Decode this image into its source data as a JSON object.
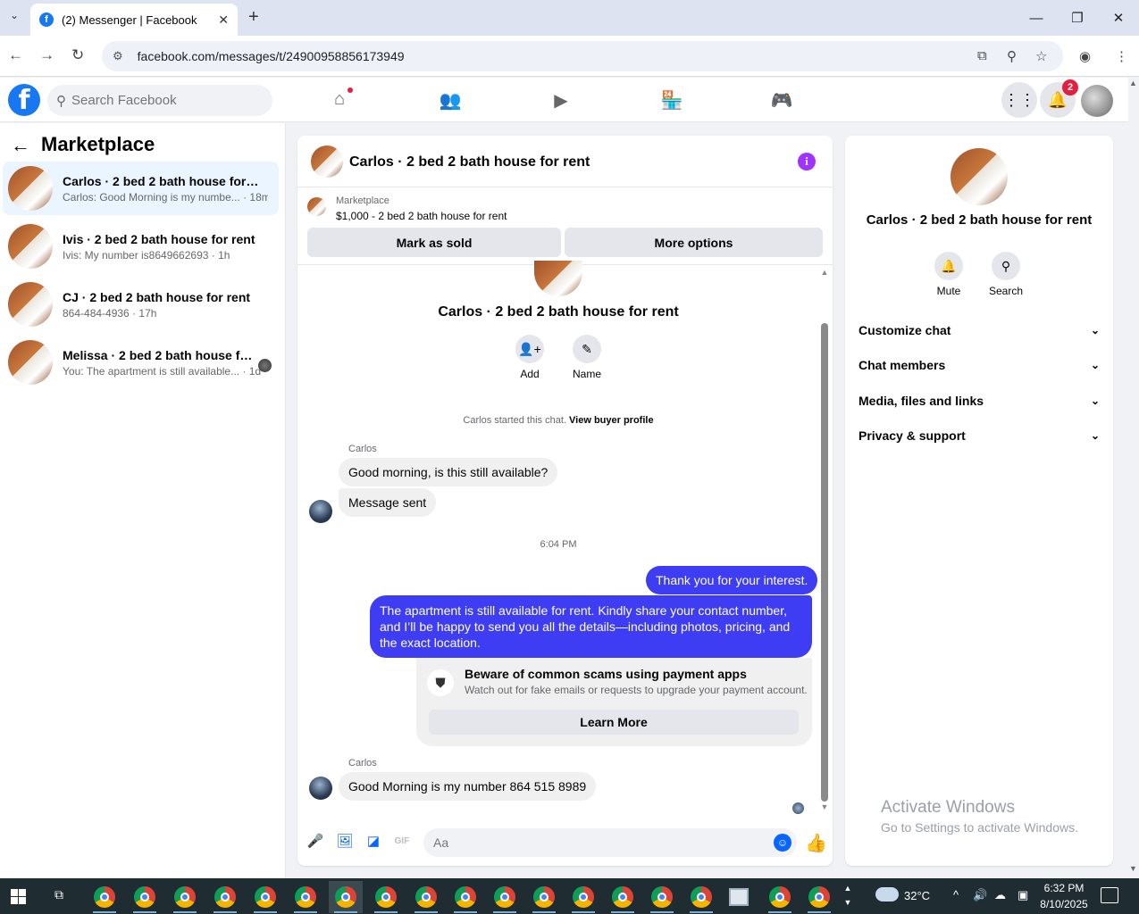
{
  "browser": {
    "tab_title": "(2) Messenger | Facebook",
    "tab_close": "✕",
    "new_tab": "+",
    "url": "facebook.com/messages/t/24900958856173949",
    "win_minimize": "—",
    "win_restore": "❐",
    "win_close": "✕"
  },
  "facebook": {
    "search_placeholder": "Search Facebook",
    "notification_count": "2"
  },
  "sidebar": {
    "title": "Marketplace",
    "conversations": [
      {
        "name": "Carlos · 2 bed 2 bath house for rent",
        "preview": "Carlos: Good Morning is my numbe... · 18m",
        "active": true
      },
      {
        "name": "Ivis · 2 bed 2 bath house for rent",
        "preview": "Ivis: My number is8649662693 · 1h",
        "active": false
      },
      {
        "name": "CJ · 2 bed 2 bath house for rent",
        "preview": "864-484-4936 · 17h",
        "active": false
      },
      {
        "name": "Melissa · 2 bed 2 bath house for...",
        "preview": "You: The apartment is still available... · 1d",
        "active": false
      }
    ]
  },
  "chat": {
    "title": "Carlos · 2 bed 2 bath house for rent",
    "marketplace_label": "Marketplace",
    "listing": "$1,000 - 2 bed 2 bath house for rent",
    "mark_sold": "Mark as sold",
    "more_options": "More options",
    "center_name": "Carlos · 2 bed 2 bath house for rent",
    "add_label": "Add",
    "name_label": "Name",
    "started_text": "Carlos started this chat.",
    "view_profile": "View buyer profile",
    "sender_1": "Carlos",
    "msg_1": "Good morning, is this still available?",
    "msg_2": "Message sent",
    "time_sep": "6:04 PM",
    "out_1": "Thank you for your interest.",
    "out_2": "The apartment is still available for rent. Kindly share your contact number, and I’ll be happy to send you all the details—including photos, pricing, and the exact location.",
    "scam_title": "Beware of common scams using payment apps",
    "scam_sub": "Watch out for fake emails or requests to upgrade your payment account.",
    "learn_more": "Learn More",
    "sender_2": "Carlos",
    "msg_3": "Good Morning is my number 864 515 8989",
    "input_placeholder": "Aa",
    "gif_label": "GIF"
  },
  "details": {
    "name": "Carlos · 2 bed 2 bath house for rent",
    "mute": "Mute",
    "search": "Search",
    "sections": [
      "Customize chat",
      "Chat members",
      "Media, files and links",
      "Privacy & support"
    ]
  },
  "watermark": {
    "title": "Activate Windows",
    "subtitle": "Go to Settings to activate Windows."
  },
  "taskbar": {
    "temperature": "32°C",
    "time": "6:32 PM",
    "date": "8/10/2025"
  }
}
